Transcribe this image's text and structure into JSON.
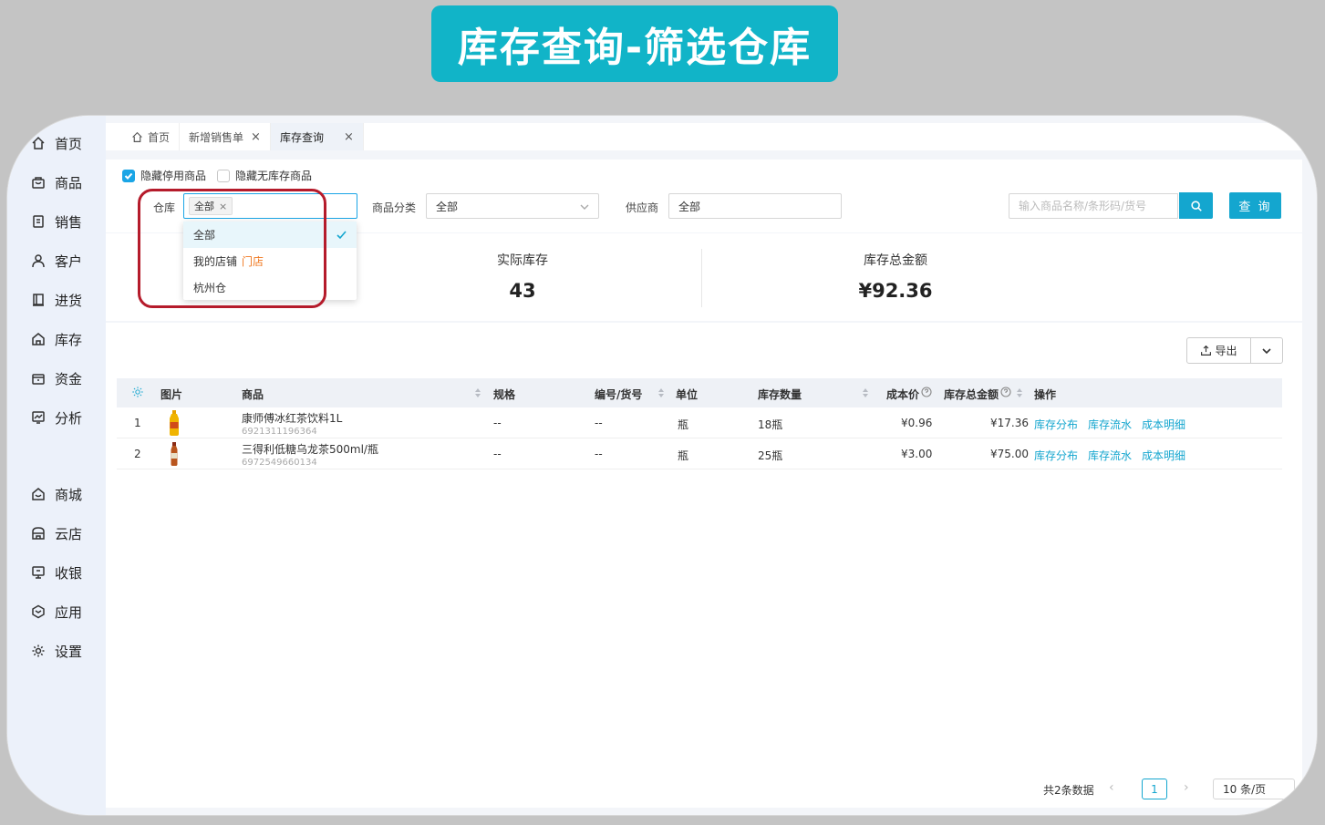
{
  "banner": {
    "title": "库存查询-筛选仓库"
  },
  "sidebar": {
    "items": [
      {
        "label": "首页",
        "icon": "home-icon"
      },
      {
        "label": "商品",
        "icon": "shopping-bag-icon"
      },
      {
        "label": "销售",
        "icon": "receipt-icon"
      },
      {
        "label": "客户",
        "icon": "user-icon"
      },
      {
        "label": "进货",
        "icon": "book-icon"
      },
      {
        "label": "库存",
        "icon": "warehouse-icon"
      },
      {
        "label": "资金",
        "icon": "wallet-icon"
      },
      {
        "label": "分析",
        "icon": "chart-icon"
      },
      {
        "label": "商城",
        "icon": "mall-icon"
      },
      {
        "label": "云店",
        "icon": "store-icon"
      },
      {
        "label": "收银",
        "icon": "monitor-icon"
      },
      {
        "label": "应用",
        "icon": "cube-icon"
      },
      {
        "label": "设置",
        "icon": "gear-icon"
      }
    ]
  },
  "tabs": [
    {
      "label": "首页"
    },
    {
      "label": "新增销售单"
    },
    {
      "label": "库存查询"
    }
  ],
  "filters": {
    "hide_disabled": "隐藏停用商品",
    "hide_no_stock": "隐藏无库存商品",
    "warehouse_label": "仓库",
    "warehouse_tag": "全部",
    "category_label": "商品分类",
    "category_value": "全部",
    "supplier_label": "供应商",
    "supplier_value": "全部",
    "search_placeholder": "输入商品名称/条形码/货号",
    "query_button": "查 询"
  },
  "dropdown": {
    "options": [
      {
        "label": "全部",
        "tag": ""
      },
      {
        "label": "我的店铺",
        "tag": "门店"
      },
      {
        "label": "杭州仓",
        "tag": ""
      }
    ]
  },
  "stats": {
    "actual_stock_label": "实际库存",
    "actual_stock_value": "43",
    "total_amount_label": "库存总金额",
    "total_amount_value": "¥92.36"
  },
  "toolbar": {
    "export_label": "导出"
  },
  "table": {
    "headers": {
      "image": "图片",
      "product": "商品",
      "spec": "规格",
      "code": "编号/货号",
      "unit": "单位",
      "qty": "库存数量",
      "cost": "成本价",
      "amount": "库存总金额",
      "ops": "操作"
    },
    "rows": [
      {
        "index": "1",
        "name": "康师傅冰红茶饮料1L",
        "barcode": "6921311196364",
        "spec": "--",
        "code": "--",
        "unit": "瓶",
        "qty": "18瓶",
        "cost": "¥0.96",
        "amount": "¥17.36"
      },
      {
        "index": "2",
        "name": "三得利低糖乌龙茶500ml/瓶",
        "barcode": "6972549660134",
        "spec": "--",
        "code": "--",
        "unit": "瓶",
        "qty": "25瓶",
        "cost": "¥3.00",
        "amount": "¥75.00"
      }
    ],
    "ops": {
      "distribution": "库存分布",
      "flow": "库存流水",
      "cost_detail": "成本明细"
    }
  },
  "pagination": {
    "total": "共2条数据",
    "page": "1",
    "page_size": "10 条/页"
  },
  "colors": {
    "accent": "#14a6cf",
    "banner": "#11b4c8",
    "highlight": "#b51b2b",
    "store_tag": "#f0771e"
  }
}
